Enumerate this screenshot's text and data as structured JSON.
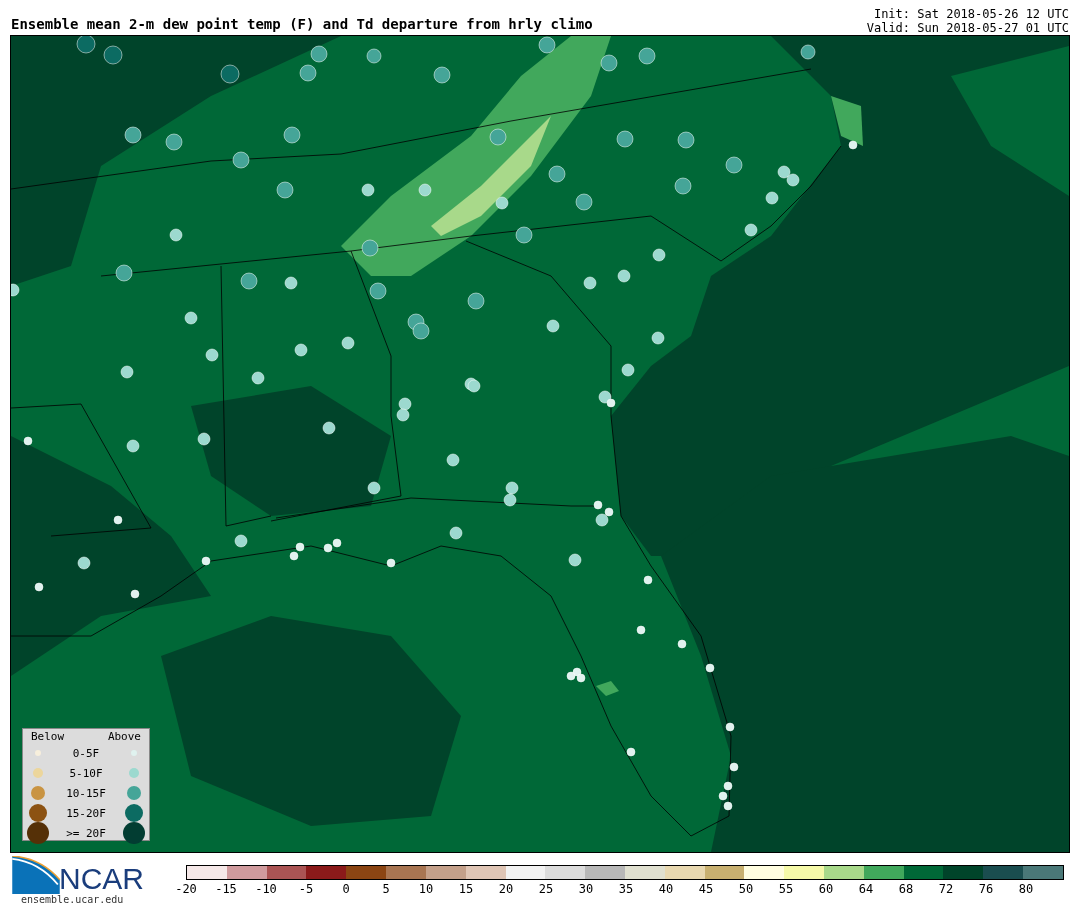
{
  "title": "Ensemble mean 2-m dew point temp (F) and Td departure from hrly climo",
  "init": "Init: Sat 2018-05-26 12 UTC",
  "valid": "Valid: Sun 2018-05-27 01 UTC",
  "legend": {
    "below_header": "Below",
    "above_header": "Above",
    "rows": [
      {
        "label": "0-5F",
        "markers": [
          {
            "color": "#f7efdc"
          },
          {
            "color": "#e0f2ef"
          }
        ]
      },
      {
        "label": "5-10F",
        "markers": [
          {
            "color": "#ecd69c"
          },
          {
            "color": "#9cd9cf"
          }
        ]
      },
      {
        "label": "10-15F",
        "markers": [
          {
            "color": "#c99442"
          },
          {
            "color": "#45a598"
          }
        ]
      },
      {
        "label": "15-20F",
        "markers": [
          {
            "color": "#8c5212"
          },
          {
            "color": "#0c6b62"
          }
        ]
      },
      {
        "label": ">= 20F",
        "markers": [
          {
            "color": "#553007"
          },
          {
            "color": "#023d32"
          }
        ]
      }
    ]
  },
  "logo": {
    "text": "NCAR",
    "url": "ensemble.ucar.edu"
  },
  "colorbar": {
    "segments": [
      {
        "color": "#f5e8e8"
      },
      {
        "color": "#d09b9e"
      },
      {
        "color": "#ab5454"
      },
      {
        "color": "#8b1a1a"
      },
      {
        "color": "#8b4513"
      },
      {
        "color": "#a87552"
      },
      {
        "color": "#c4a08a"
      },
      {
        "color": "#dfc5b5"
      },
      {
        "color": "#f2f2f2"
      },
      {
        "color": "#dcdcdc"
      },
      {
        "color": "#b8b8b8"
      },
      {
        "color": "#e0e0d0"
      },
      {
        "color": "#e8d8b0"
      },
      {
        "color": "#c8b070"
      },
      {
        "color": "#fffde0"
      },
      {
        "color": "#f5f9a8"
      },
      {
        "color": "#a8d98a"
      },
      {
        "color": "#41a85c"
      },
      {
        "color": "#006837"
      },
      {
        "color": "#00442a"
      },
      {
        "color": "#1a4d4f"
      },
      {
        "color": "#4a7878"
      }
    ],
    "ticks": [
      "-20",
      "-15",
      "-10",
      "-5",
      "0",
      "5",
      "10",
      "15",
      "20",
      "25",
      "30",
      "35",
      "40",
      "45",
      "50",
      "55",
      "60",
      "64",
      "68",
      "72",
      "76",
      "80"
    ]
  }
}
